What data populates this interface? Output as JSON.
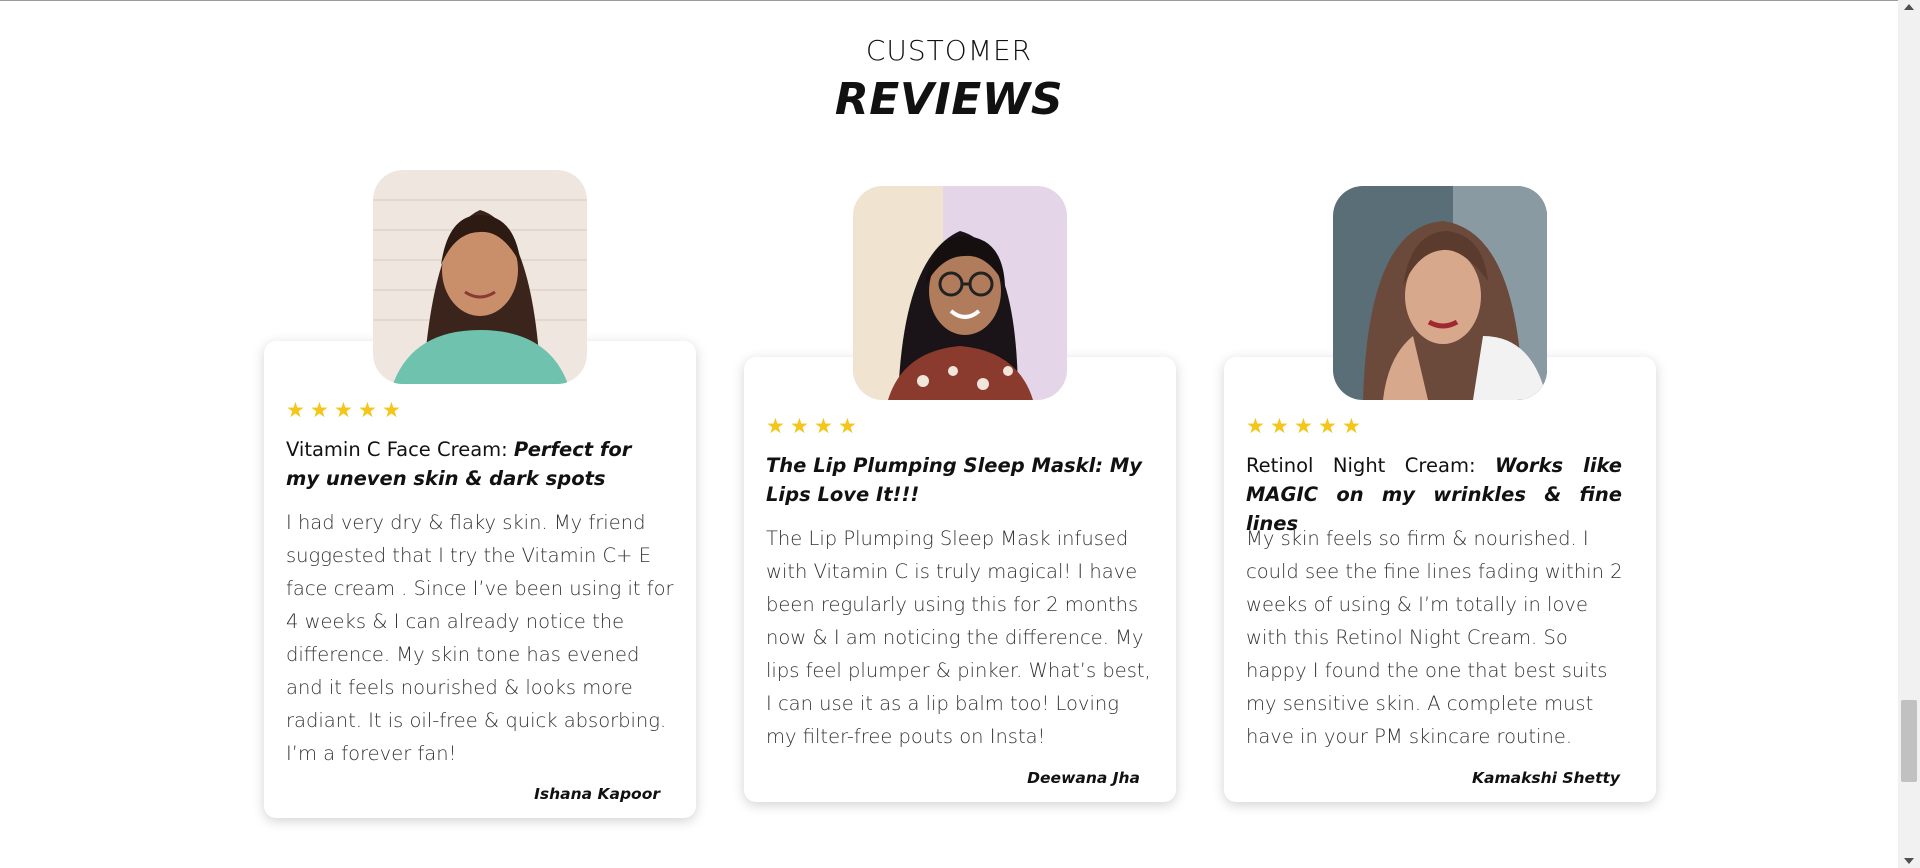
{
  "section": {
    "subtitle": "CUSTOMER",
    "title": "REVIEWS"
  },
  "reviews": [
    {
      "rating": 5,
      "product": "Vitamin C Face Cream: ",
      "headline": "Perfect for my uneven skin & dark spots",
      "text": "I had very dry & flaky skin. My friend suggested that I try the Vitamin C+ E face cream . Since I’ve been using it for 4 weeks & I can already notice the difference. My skin tone has evened and it feels nourished & looks more radiant. It is oil-free & quick absorbing. I’m a forever fan!",
      "author": "Ishana Kapoor"
    },
    {
      "rating": 4,
      "product": "",
      "headline": "The Lip Plumping Sleep Maskl: My Lips Love It!!!",
      "text": "The Lip Plumping Sleep Mask infused with Vitamin C is truly magical! I have been regularly using this for 2 months now & I am noticing the difference. My lips feel plumper & pinker. What’s best, I can use it as a lip balm too! Loving my filter-free pouts on Insta!",
      "author": "Deewana Jha"
    },
    {
      "rating": 5,
      "product": "Retinol Night Cream: ",
      "headline": "Works like MAGIC on my wrinkles & fine lines",
      "text": "My skin feels so firm & nourished. I could see the fine lines fading within 2 weeks of using & I’m totally in love with this Retinol Night Cream. So happy I found the one that best suits my sensitive skin. A complete must have in your PM skincare routine.",
      "author": "Kamakshi Shetty"
    }
  ],
  "colors": {
    "star": "#f5c518",
    "text": "#333333",
    "heading": "#111111"
  },
  "icons": {
    "star": "star-icon",
    "avatar": "avatar"
  }
}
